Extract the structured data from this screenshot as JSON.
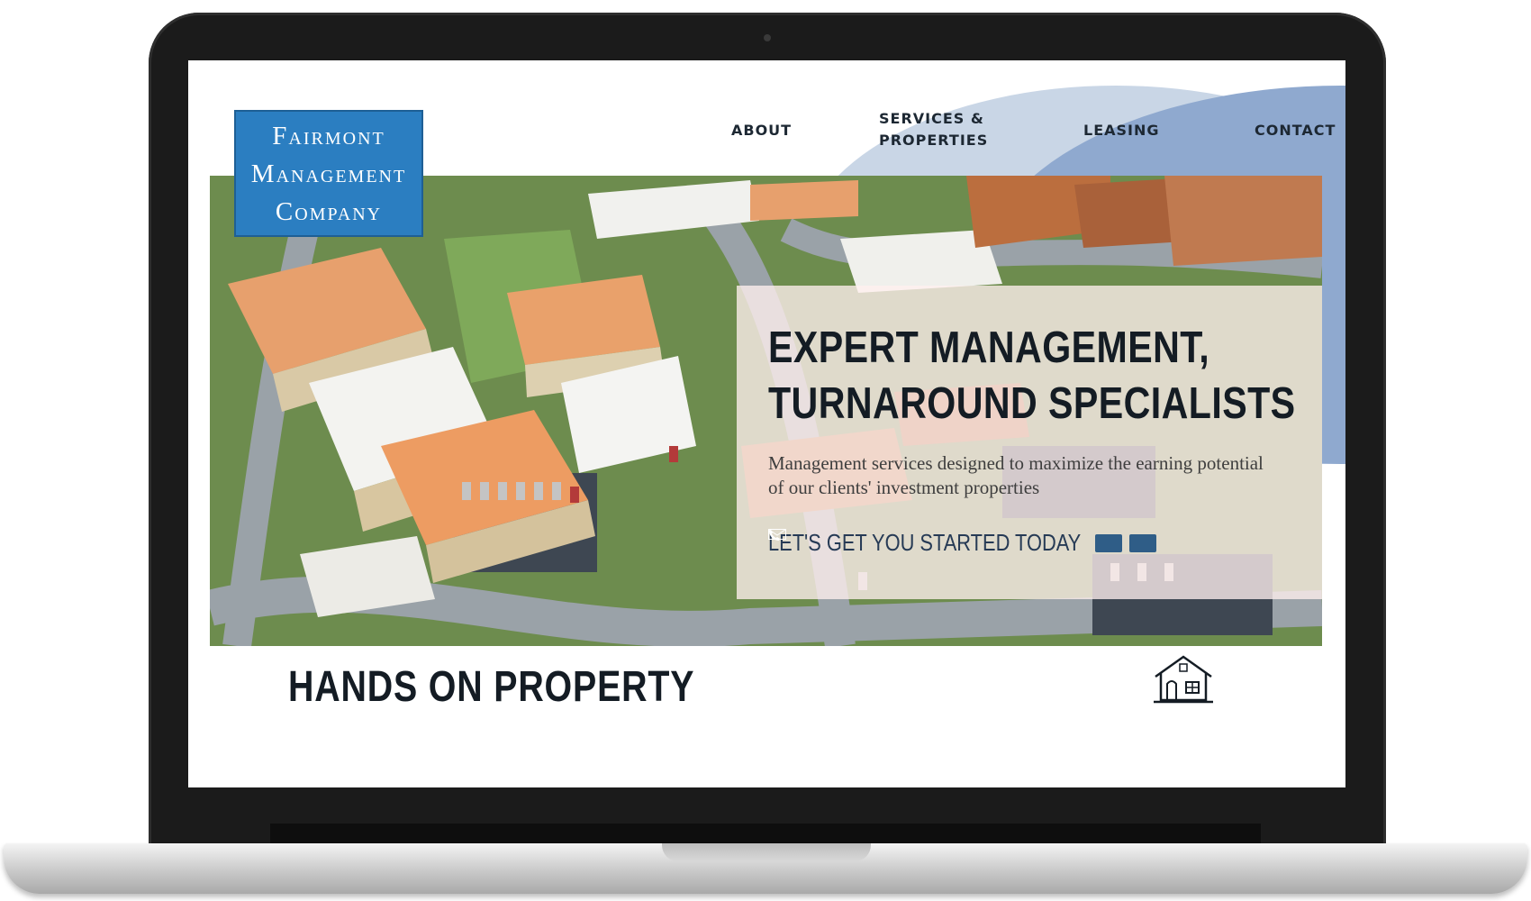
{
  "logo": {
    "line1": "Fairmont",
    "line2": "Management",
    "line3": "Company"
  },
  "nav": {
    "about": "ABOUT",
    "services_line1": "SERVICES &",
    "services_line2": "PROPERTIES",
    "leasing": "LEASING",
    "contact": "CONTACT"
  },
  "hero": {
    "title_line1": "EXPERT MANAGEMENT,",
    "title_line2": "TURNAROUND SPECIALISTS",
    "subtitle": "Management services designed to maximize the earning potential of our clients' investment properties",
    "cta": "LET'S GET YOU STARTED TODAY",
    "email_icon": "envelope-icon",
    "phone_icon": "phone-icon"
  },
  "section": {
    "title": "HANDS ON PROPERTY",
    "icon": "house-icon"
  },
  "colors": {
    "logo_bg": "#2b7ec1",
    "nav_arc_light": "#c9d6e6",
    "nav_arc_dark": "#8fa9cf",
    "cta_text": "#263a55",
    "title_text": "#141c24"
  }
}
